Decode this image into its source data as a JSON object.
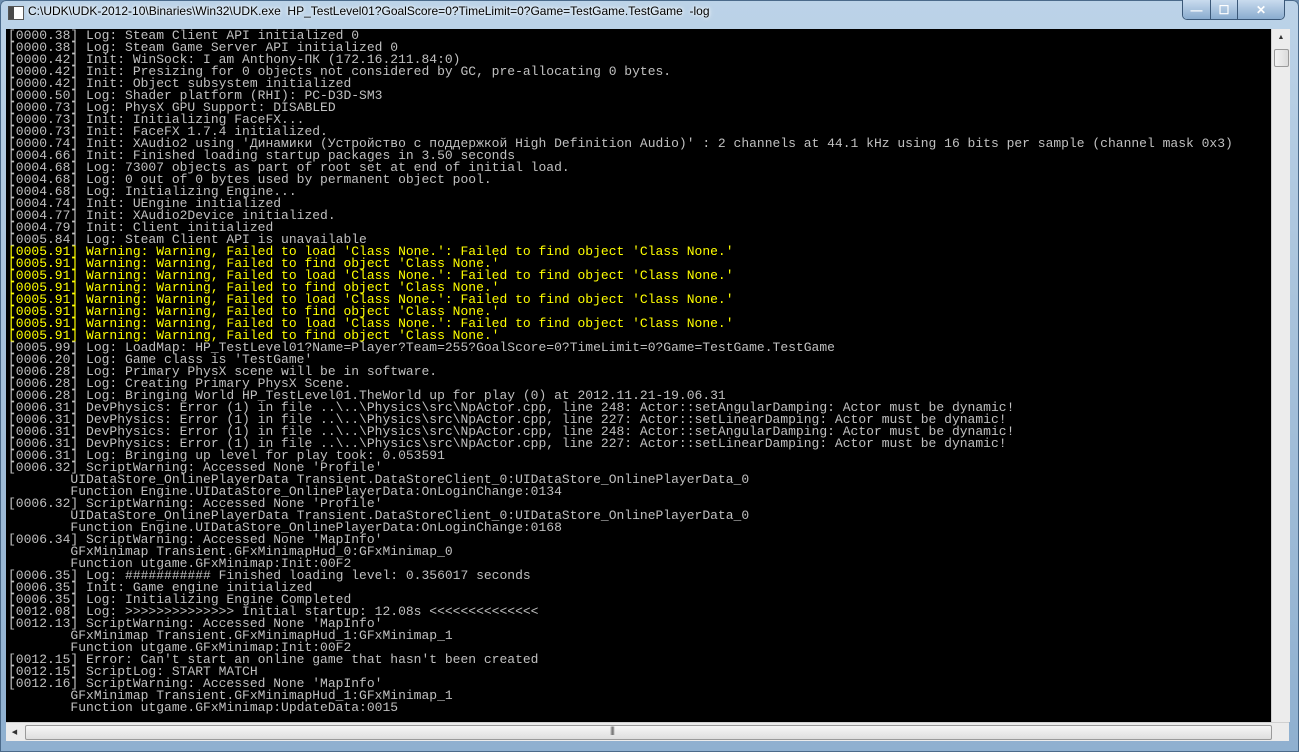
{
  "window": {
    "title": "C:\\UDK\\UDK-2012-10\\Binaries\\Win32\\UDK.exe  HP_TestLevel01?GoalScore=0?TimeLimit=0?Game=TestGame.TestGame  -log",
    "minimize": "—",
    "maximize": "☐",
    "close": "✕"
  },
  "colors": {
    "normal": "#c0c0c0",
    "warning": "#ffff00",
    "background": "#000000"
  },
  "console": {
    "lines": [
      {
        "text": "[0000.38] Log: Steam Client API initialized 0",
        "type": "normal"
      },
      {
        "text": "[0000.38] Log: Steam Game Server API initialized 0",
        "type": "normal"
      },
      {
        "text": "[0000.42] Init: WinSock: I am Anthony-ПК (172.16.211.84:0)",
        "type": "normal"
      },
      {
        "text": "[0000.42] Init: Presizing for 0 objects not considered by GC, pre-allocating 0 bytes.",
        "type": "normal"
      },
      {
        "text": "[0000.42] Init: Object subsystem initialized",
        "type": "normal"
      },
      {
        "text": "[0000.50] Log: Shader platform (RHI): PC-D3D-SM3",
        "type": "normal"
      },
      {
        "text": "[0000.73] Log: PhysX GPU Support: DISABLED",
        "type": "normal"
      },
      {
        "text": "[0000.73] Init: Initializing FaceFX...",
        "type": "normal"
      },
      {
        "text": "[0000.73] Init: FaceFX 1.7.4 initialized.",
        "type": "normal"
      },
      {
        "text": "[0000.74] Init: XAudio2 using 'Динамики (Устройство с поддержкой High Definition Audio)' : 2 channels at 44.1 kHz using 16 bits per sample (channel mask 0x3)",
        "type": "normal"
      },
      {
        "text": "[0004.66] Init: Finished loading startup packages in 3.50 seconds",
        "type": "normal"
      },
      {
        "text": "[0004.68] Log: 73007 objects as part of root set at end of initial load.",
        "type": "normal"
      },
      {
        "text": "[0004.68] Log: 0 out of 0 bytes used by permanent object pool.",
        "type": "normal"
      },
      {
        "text": "[0004.68] Log: Initializing Engine...",
        "type": "normal"
      },
      {
        "text": "[0004.74] Init: UEngine initialized",
        "type": "normal"
      },
      {
        "text": "[0004.77] Init: XAudio2Device initialized.",
        "type": "normal"
      },
      {
        "text": "[0004.79] Init: Client initialized",
        "type": "normal"
      },
      {
        "text": "[0005.84] Log: Steam Client API is unavailable",
        "type": "normal"
      },
      {
        "text": "[0005.91] Warning: Warning, Failed to load 'Class None.': Failed to find object 'Class None.'",
        "type": "warn"
      },
      {
        "text": "[0005.91] Warning: Warning, Failed to find object 'Class None.'",
        "type": "warn"
      },
      {
        "text": "[0005.91] Warning: Warning, Failed to load 'Class None.': Failed to find object 'Class None.'",
        "type": "warn"
      },
      {
        "text": "[0005.91] Warning: Warning, Failed to find object 'Class None.'",
        "type": "warn"
      },
      {
        "text": "[0005.91] Warning: Warning, Failed to load 'Class None.': Failed to find object 'Class None.'",
        "type": "warn"
      },
      {
        "text": "[0005.91] Warning: Warning, Failed to find object 'Class None.'",
        "type": "warn"
      },
      {
        "text": "[0005.91] Warning: Warning, Failed to load 'Class None.': Failed to find object 'Class None.'",
        "type": "warn"
      },
      {
        "text": "[0005.91] Warning: Warning, Failed to find object 'Class None.'",
        "type": "warn"
      },
      {
        "text": "[0005.99] Log: LoadMap: HP_TestLevel01?Name=Player?Team=255?GoalScore=0?TimeLimit=0?Game=TestGame.TestGame",
        "type": "normal"
      },
      {
        "text": "[0006.20] Log: Game class is 'TestGame'",
        "type": "normal"
      },
      {
        "text": "[0006.28] Log: Primary PhysX scene will be in software.",
        "type": "normal"
      },
      {
        "text": "[0006.28] Log: Creating Primary PhysX Scene.",
        "type": "normal"
      },
      {
        "text": "[0006.28] Log: Bringing World HP_TestLevel01.TheWorld up for play (0) at 2012.11.21-19.06.31",
        "type": "normal"
      },
      {
        "text": "[0006.31] DevPhysics: Error (1) in file ..\\..\\Physics\\src\\NpActor.cpp, line 248: Actor::setAngularDamping: Actor must be dynamic!",
        "type": "normal"
      },
      {
        "text": "[0006.31] DevPhysics: Error (1) in file ..\\..\\Physics\\src\\NpActor.cpp, line 227: Actor::setLinearDamping: Actor must be dynamic!",
        "type": "normal"
      },
      {
        "text": "[0006.31] DevPhysics: Error (1) in file ..\\..\\Physics\\src\\NpActor.cpp, line 248: Actor::setAngularDamping: Actor must be dynamic!",
        "type": "normal"
      },
      {
        "text": "[0006.31] DevPhysics: Error (1) in file ..\\..\\Physics\\src\\NpActor.cpp, line 227: Actor::setLinearDamping: Actor must be dynamic!",
        "type": "normal"
      },
      {
        "text": "[0006.31] Log: Bringing up level for play took: 0.053591",
        "type": "normal"
      },
      {
        "text": "[0006.32] ScriptWarning: Accessed None 'Profile'",
        "type": "normal"
      },
      {
        "text": "        UIDataStore_OnlinePlayerData Transient.DataStoreClient_0:UIDataStore_OnlinePlayerData_0",
        "type": "normal"
      },
      {
        "text": "        Function Engine.UIDataStore_OnlinePlayerData:OnLoginChange:0134",
        "type": "normal"
      },
      {
        "text": "[0006.32] ScriptWarning: Accessed None 'Profile'",
        "type": "normal"
      },
      {
        "text": "        UIDataStore_OnlinePlayerData Transient.DataStoreClient_0:UIDataStore_OnlinePlayerData_0",
        "type": "normal"
      },
      {
        "text": "        Function Engine.UIDataStore_OnlinePlayerData:OnLoginChange:0168",
        "type": "normal"
      },
      {
        "text": "[0006.34] ScriptWarning: Accessed None 'MapInfo'",
        "type": "normal"
      },
      {
        "text": "        GFxMinimap Transient.GFxMinimapHud_0:GFxMinimap_0",
        "type": "normal"
      },
      {
        "text": "        Function utgame.GFxMinimap:Init:00F2",
        "type": "normal"
      },
      {
        "text": "[0006.35] Log: ########### Finished loading level: 0.356017 seconds",
        "type": "normal"
      },
      {
        "text": "[0006.35] Init: Game engine initialized",
        "type": "normal"
      },
      {
        "text": "[0006.35] Log: Initializing Engine Completed",
        "type": "normal"
      },
      {
        "text": "[0012.08] Log: >>>>>>>>>>>>>> Initial startup: 12.08s <<<<<<<<<<<<<<",
        "type": "normal"
      },
      {
        "text": "[0012.13] ScriptWarning: Accessed None 'MapInfo'",
        "type": "normal"
      },
      {
        "text": "        GFxMinimap Transient.GFxMinimapHud_1:GFxMinimap_1",
        "type": "normal"
      },
      {
        "text": "        Function utgame.GFxMinimap:Init:00F2",
        "type": "normal"
      },
      {
        "text": "[0012.15] Error: Can't start an online game that hasn't been created",
        "type": "normal"
      },
      {
        "text": "[0012.15] ScriptLog: START MATCH",
        "type": "normal"
      },
      {
        "text": "[0012.16] ScriptWarning: Accessed None 'MapInfo'",
        "type": "normal"
      },
      {
        "text": "        GFxMinimap Transient.GFxMinimapHud_1:GFxMinimap_1",
        "type": "normal"
      },
      {
        "text": "        Function utgame.GFxMinimap:UpdateData:0015",
        "type": "normal"
      }
    ]
  },
  "scrollbars": {
    "up_arrow": "▲",
    "left_arrow": "◀",
    "grip": "|||"
  }
}
